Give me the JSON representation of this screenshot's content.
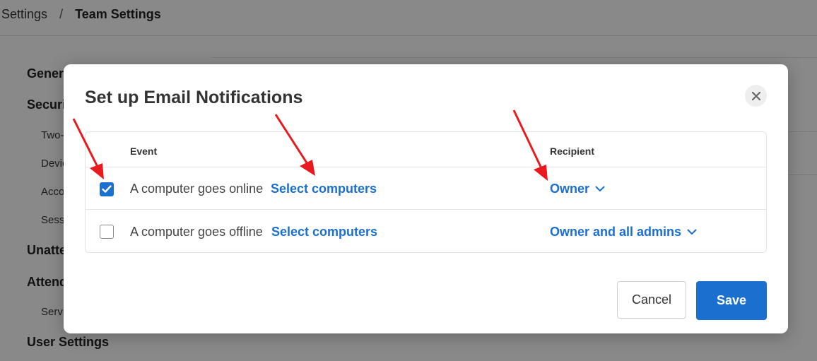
{
  "breadcrumb": {
    "parent": "Settings",
    "separator": "/",
    "current": "Team Settings"
  },
  "sidebar": {
    "items": [
      {
        "label": "General"
      },
      {
        "label": "Security"
      },
      {
        "label": "Two-factor authentication"
      },
      {
        "label": "Devices"
      },
      {
        "label": "Account"
      },
      {
        "label": "Session"
      },
      {
        "label": "Unattended"
      },
      {
        "label": "Attended"
      },
      {
        "label": "Service"
      },
      {
        "label": "User Settings"
      }
    ]
  },
  "modal": {
    "title": "Set up Email Notifications",
    "close_icon": "close-icon",
    "columns": {
      "event": "Event",
      "recipient": "Recipient"
    },
    "rows": [
      {
        "checked": true,
        "event": "A computer goes online",
        "link": "Select computers",
        "recipient": "Owner"
      },
      {
        "checked": false,
        "event": "A computer goes offline",
        "link": "Select computers",
        "recipient": "Owner and all admins"
      }
    ],
    "cancel_label": "Cancel",
    "save_label": "Save"
  },
  "colors": {
    "accent": "#1a6fcf",
    "annotation_arrow": "#e8191f",
    "overlay": "rgba(0,0,0,0.45)"
  }
}
